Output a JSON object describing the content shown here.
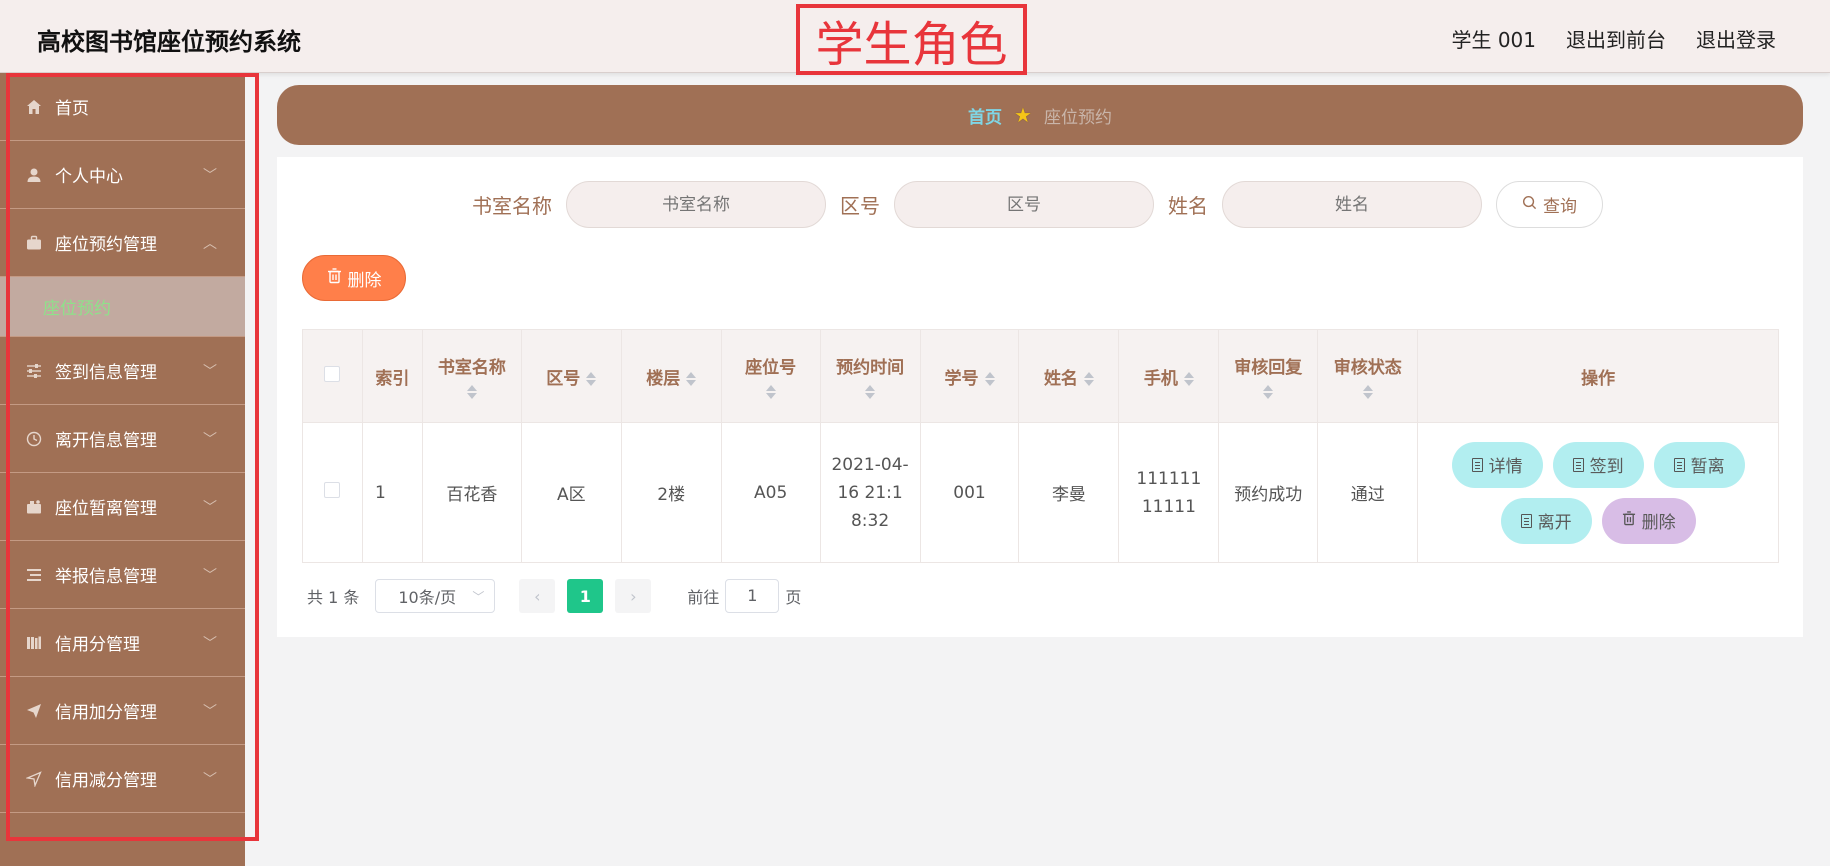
{
  "header": {
    "title": "高校图书馆座位预约系统",
    "role_label": "学生角色",
    "user": "学生 001",
    "front_link": "退出到前台",
    "logout": "退出登录"
  },
  "sidebar": {
    "items": [
      {
        "label": "首页",
        "icon": "home-icon"
      },
      {
        "label": "个人中心",
        "icon": "user-icon"
      },
      {
        "label": "座位预约管理",
        "icon": "briefcase-icon"
      },
      {
        "label": "签到信息管理",
        "icon": "sliders-icon"
      },
      {
        "label": "离开信息管理",
        "icon": "clock-icon"
      },
      {
        "label": "座位暂离管理",
        "icon": "suitcase-icon"
      },
      {
        "label": "举报信息管理",
        "icon": "list-icon"
      },
      {
        "label": "信用分管理",
        "icon": "books-icon"
      },
      {
        "label": "信用加分管理",
        "icon": "send-icon"
      },
      {
        "label": "信用减分管理",
        "icon": "navigation-icon"
      }
    ],
    "sub_item": "座位预约"
  },
  "breadcrumb": {
    "home": "首页",
    "current": "座位预约"
  },
  "search": {
    "room_label": "书室名称",
    "room_placeholder": "书室名称",
    "area_label": "区号",
    "area_placeholder": "区号",
    "name_label": "姓名",
    "name_placeholder": "姓名",
    "query_button": "查询"
  },
  "toolbar": {
    "delete_label": "删除"
  },
  "table": {
    "headers": [
      "索引",
      "书室名称",
      "区号",
      "楼层",
      "座位号",
      "预约时间",
      "学号",
      "姓名",
      "手机",
      "审核回复",
      "审核状态",
      "操作"
    ],
    "rows": [
      {
        "index": "1",
        "room": "百花香",
        "area": "A区",
        "floor": "2楼",
        "seat": "A05",
        "time": "2021-04-16 21:18:32",
        "student_no": "001",
        "name": "李曼",
        "phone": "11111111111",
        "reply": "预约成功",
        "status": "通过"
      }
    ],
    "actions": {
      "detail": "详情",
      "signin": "签到",
      "leave_temp": "暂离",
      "leave": "离开",
      "delete": "删除"
    }
  },
  "pagination": {
    "total": "共 1 条",
    "page_size": "10条/页",
    "current_page": "1",
    "goto_prefix": "前往",
    "goto_value": "1",
    "goto_suffix": "页"
  },
  "colors": {
    "sidebar_bg": "#a07055",
    "header_bg": "#f5eeed",
    "accent_red": "#e8353b",
    "delete_orange": "#ff7f4a",
    "action_cyan": "#b2eef0",
    "action_purple": "#d8bde6",
    "page_green": "#1fc68a"
  }
}
